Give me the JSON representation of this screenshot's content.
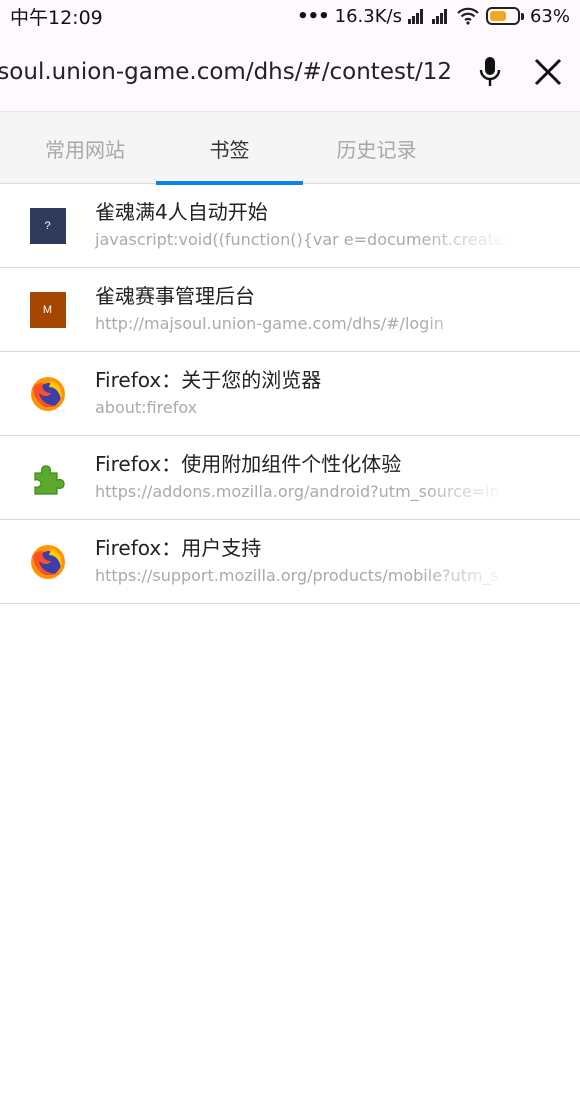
{
  "status_bar": {
    "time": "中午12:09",
    "dots": "•••",
    "speed": "16.3K/s",
    "battery_percent": "63%",
    "battery_level": 0.63
  },
  "url_bar": {
    "url": "soul.union-game.com/dhs/#/contest/12"
  },
  "tabs": [
    {
      "label": "常用网站",
      "active": false
    },
    {
      "label": "书签",
      "active": true
    },
    {
      "label": "历史记录",
      "active": false
    }
  ],
  "bookmarks": [
    {
      "title": "雀魂满4人自动开始",
      "url": "javascript:void((function(){var e=document.createEl",
      "icon": "question-favicon",
      "letter": "?",
      "color": "#2f3a5c"
    },
    {
      "title": "雀魂赛事管理后台",
      "url": "http://majsoul.union-game.com/dhs/#/login",
      "icon": "letter-favicon",
      "letter": "M",
      "color": "#a34700"
    },
    {
      "title": "Firefox：关于您的浏览器",
      "url": "about:firefox",
      "icon": "firefox-icon"
    },
    {
      "title": "Firefox：使用附加组件个性化体验",
      "url": "https://addons.mozilla.org/android?utm_source=in",
      "icon": "puzzle-icon"
    },
    {
      "title": "Firefox：用户支持",
      "url": "https://support.mozilla.org/products/mobile?utm_s",
      "icon": "firefox-icon"
    }
  ]
}
